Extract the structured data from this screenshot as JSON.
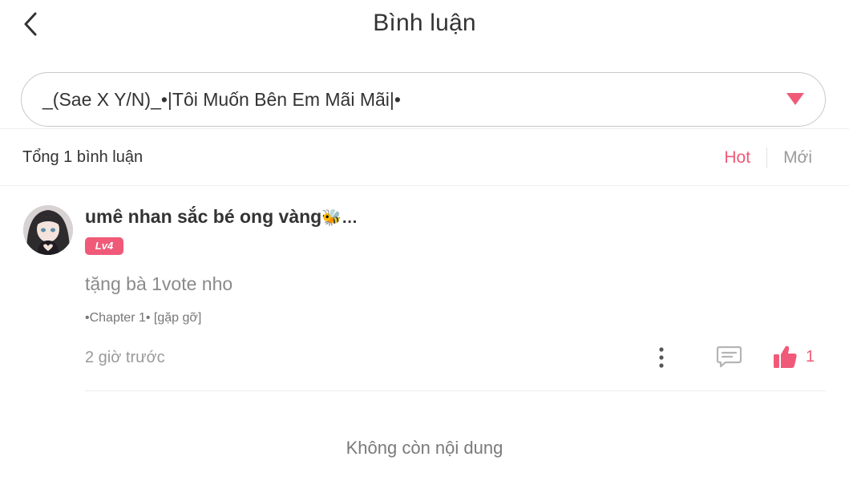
{
  "header": {
    "title": "Bình luận",
    "back_icon": "chevron-left-icon"
  },
  "story_selector": {
    "selected_value": "_(Sae X Y/N)_•|Tôi Muốn Bên Em Mãi Mãi|•",
    "arrow_icon": "caret-down-icon",
    "arrow_color": "#f05a78"
  },
  "summary": {
    "total_text": "Tổng 1 bình luận"
  },
  "sort_tabs": [
    {
      "label": "Hot",
      "active": true
    },
    {
      "label": "Mới",
      "active": false
    }
  ],
  "comments": [
    {
      "username": "umê nhan sắc bé ong vàng",
      "username_suffix": "🐝…",
      "level": "Lv4",
      "text": "tặng bà 1vote nho",
      "chapter": "•Chapter 1• [gặp gỡ]",
      "time": "2 giờ trước",
      "likes": "1"
    }
  ],
  "footer": {
    "end_text": "Không còn nội dung"
  },
  "colors": {
    "accent": "#f05a78",
    "text_primary": "#333333",
    "text_muted": "#9a9a9a"
  }
}
